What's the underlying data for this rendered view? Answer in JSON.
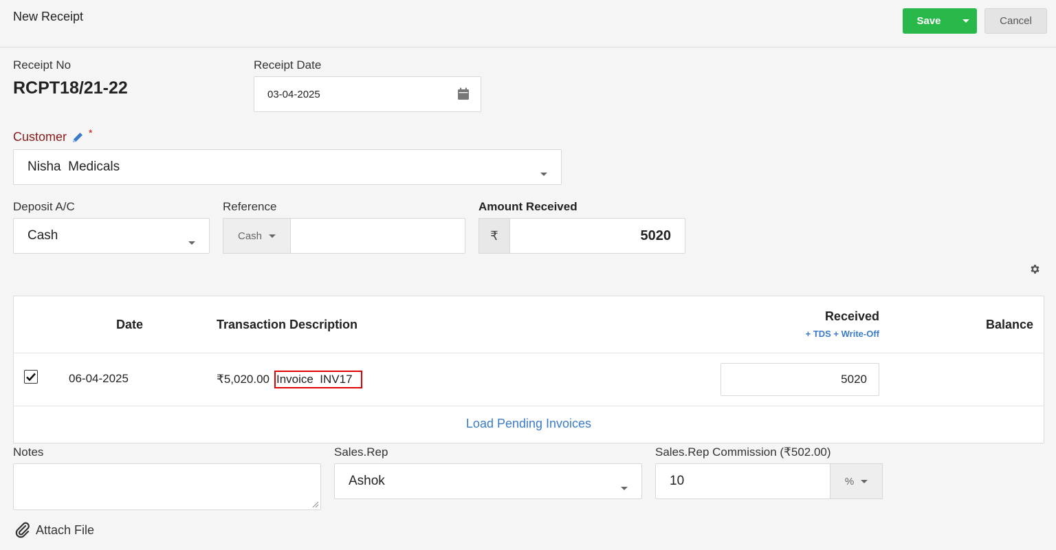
{
  "header": {
    "title": "New Receipt",
    "save_label": "Save",
    "cancel_label": "Cancel"
  },
  "receipt": {
    "no_label": "Receipt No",
    "no_value": "RCPT18/21-22",
    "date_label": "Receipt Date",
    "date_value": "03-04-2025"
  },
  "customer": {
    "label": "Customer",
    "required_mark": "*",
    "value": "Nisha  Medicals"
  },
  "deposit": {
    "label": "Deposit A/C",
    "value": "Cash"
  },
  "reference": {
    "label": "Reference",
    "type_value": "Cash",
    "value": ""
  },
  "amount": {
    "label": "Amount Received",
    "currency_symbol": "₹",
    "value": "5020"
  },
  "table": {
    "headers": {
      "date": "Date",
      "description": "Transaction Description",
      "received": "Received",
      "received_link": "+ TDS + Write-Off",
      "balance": "Balance"
    },
    "rows": [
      {
        "checked": true,
        "date": "06-04-2025",
        "amount": "₹5,020.00",
        "invoice": "Invoice  INV17",
        "received": "5020",
        "balance": ""
      }
    ],
    "load_pending_label": "Load Pending Invoices"
  },
  "notes": {
    "label": "Notes",
    "value": ""
  },
  "sales_rep": {
    "label": "Sales.Rep",
    "value": "Ashok"
  },
  "commission": {
    "label": "Sales.Rep Commission (₹502.00)",
    "value": "10",
    "unit": "%"
  },
  "attach_label": "Attach File",
  "colors": {
    "save_green": "#28b94a",
    "link_blue": "#3a7bc8",
    "customer_label": "#8b1a1a",
    "highlight_red": "#dd0000"
  },
  "icons": [
    "calendar-icon",
    "pencil-icon",
    "gear-icon",
    "checkmark-icon",
    "paperclip-icon"
  ]
}
